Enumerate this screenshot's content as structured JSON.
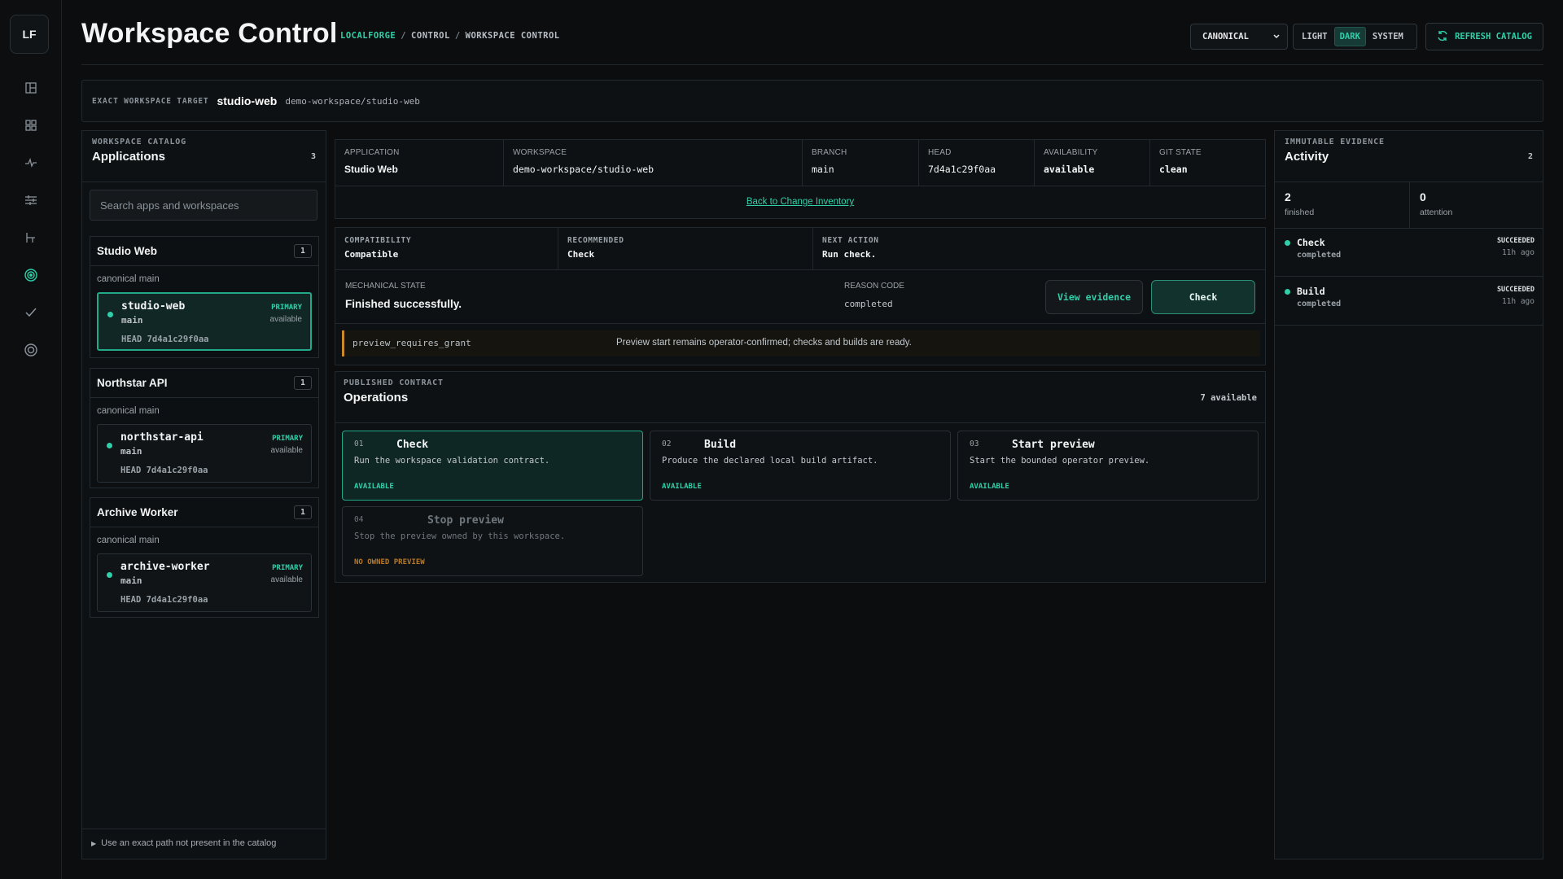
{
  "rail": {
    "logo": "LF",
    "items": [
      {
        "icon": "dashboard-icon"
      },
      {
        "icon": "grid-icon"
      },
      {
        "icon": "activity-icon"
      },
      {
        "icon": "sliders-icon"
      },
      {
        "icon": "branch-icon"
      },
      {
        "icon": "target-icon",
        "active": true
      },
      {
        "icon": "check-icon"
      },
      {
        "icon": "settings-icon"
      }
    ]
  },
  "header": {
    "title": "Workspace Control",
    "breadcrumb": [
      "LOCALFORGE",
      "CONTROL",
      "WORKSPACE CONTROL"
    ],
    "mode_select": "CANONICAL",
    "theme": {
      "options": [
        "LIGHT",
        "DARK",
        "SYSTEM"
      ],
      "selected": "DARK"
    },
    "refresh_label": "REFRESH CATALOG"
  },
  "target": {
    "label": "EXACT WORKSPACE TARGET",
    "name": "studio-web",
    "path": "demo-workspace/studio-web"
  },
  "catalog": {
    "eyebrow": "WORKSPACE CATALOG",
    "title": "Applications",
    "count": "3",
    "search_placeholder": "Search apps and workspaces",
    "groups": [
      {
        "title": "Studio Web",
        "count": "1",
        "subtitle": "canonical main",
        "workspace": {
          "name": "studio-web",
          "branch": "main",
          "head": "HEAD 7d4a1c29f0aa",
          "badge": "PRIMARY",
          "status": "available",
          "selected": true
        }
      },
      {
        "title": "Northstar API",
        "count": "1",
        "subtitle": "canonical main",
        "workspace": {
          "name": "northstar-api",
          "branch": "main",
          "head": "HEAD 7d4a1c29f0aa",
          "badge": "PRIMARY",
          "status": "available",
          "selected": false
        }
      },
      {
        "title": "Archive Worker",
        "count": "1",
        "subtitle": "canonical main",
        "workspace": {
          "name": "archive-worker",
          "branch": "main",
          "head": "HEAD 7d4a1c29f0aa",
          "badge": "PRIMARY",
          "status": "available",
          "selected": false
        }
      }
    ],
    "footer": "Use an exact path not present in the catalog"
  },
  "facts": {
    "application": {
      "label": "APPLICATION",
      "value": "Studio Web"
    },
    "workspace": {
      "label": "WORKSPACE",
      "value": "demo-workspace/studio-web"
    },
    "branch": {
      "label": "BRANCH",
      "value": "main"
    },
    "head": {
      "label": "HEAD",
      "value": "7d4a1c29f0aa"
    },
    "availability": {
      "label": "AVAILABILITY",
      "value": "available"
    },
    "git_state": {
      "label": "GIT STATE",
      "value": "clean"
    },
    "back_link": "Back to Change Inventory"
  },
  "state": {
    "compatibility": {
      "label": "COMPATIBILITY",
      "value": "Compatible"
    },
    "recommended": {
      "label": "RECOMMENDED",
      "value": "Check"
    },
    "next_action": {
      "label": "NEXT ACTION",
      "value": "Run check."
    },
    "mechanical_label": "MECHANICAL STATE",
    "mechanical_value": "Finished successfully.",
    "reason_label": "REASON CODE",
    "reason_value": "completed",
    "view_evidence": "View evidence",
    "check_button": "Check",
    "notice_code": "preview_requires_grant",
    "notice_message": "Preview start remains operator-confirmed; checks and builds are ready."
  },
  "operations": {
    "eyebrow": "PUBLISHED CONTRACT",
    "title": "Operations",
    "available_count": "7 available",
    "items": [
      {
        "num": "01",
        "name": "Check",
        "desc": "Run the workspace validation contract.",
        "status": "AVAILABLE"
      },
      {
        "num": "02",
        "name": "Build",
        "desc": "Produce the declared local build artifact.",
        "status": "AVAILABLE"
      },
      {
        "num": "03",
        "name": "Start preview",
        "desc": "Start the bounded operator preview.",
        "status": "AVAILABLE"
      },
      {
        "num": "04",
        "name": "Stop preview",
        "desc": "Stop the preview owned by this workspace.",
        "status": "NO OWNED PREVIEW"
      }
    ]
  },
  "activity": {
    "eyebrow": "IMMUTABLE EVIDENCE",
    "title": "Activity",
    "count": "2",
    "finished": {
      "value": "2",
      "label": "finished"
    },
    "attention": {
      "value": "0",
      "label": "attention"
    },
    "events": [
      {
        "name": "Check",
        "status": "completed",
        "badge": "SUCCEEDED",
        "time": "11h ago"
      },
      {
        "name": "Build",
        "status": "completed",
        "badge": "SUCCEEDED",
        "time": "11h ago"
      }
    ]
  },
  "colors": {
    "accent": "#2fd0a9",
    "warning": "#c98a2b",
    "background": "#0b0d0f"
  }
}
